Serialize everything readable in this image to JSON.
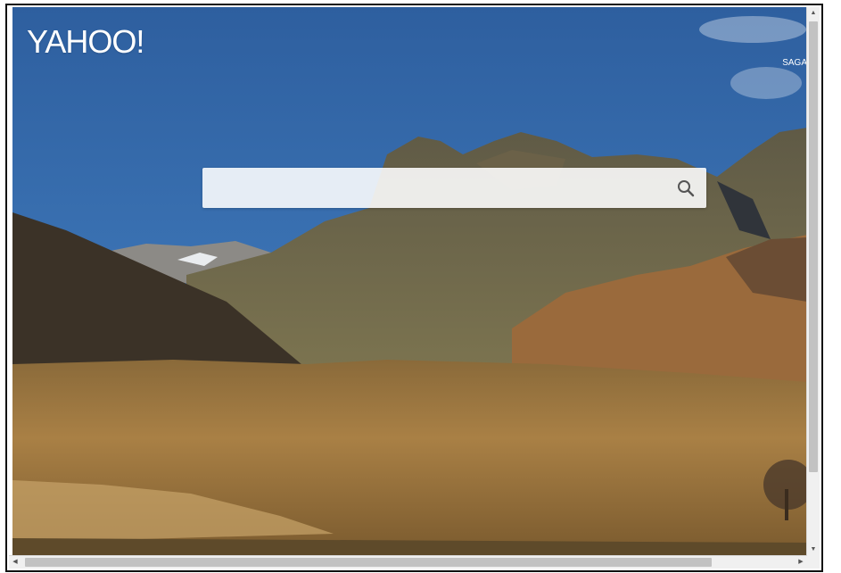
{
  "header": {
    "logo_text": "YAHOO!",
    "top_right_link": "SAGA"
  },
  "search": {
    "value": "",
    "placeholder": "",
    "button_icon": "magnifier-icon"
  },
  "background": {
    "description_colors": {
      "sky_top": "#2f64a6",
      "sky_bottom": "#5a8bbf",
      "mountain": "#6d6a4c",
      "field": "#a2783f"
    }
  },
  "scrollbars": {
    "vertical": "scrollbar-vertical",
    "horizontal": "scrollbar-horizontal"
  }
}
